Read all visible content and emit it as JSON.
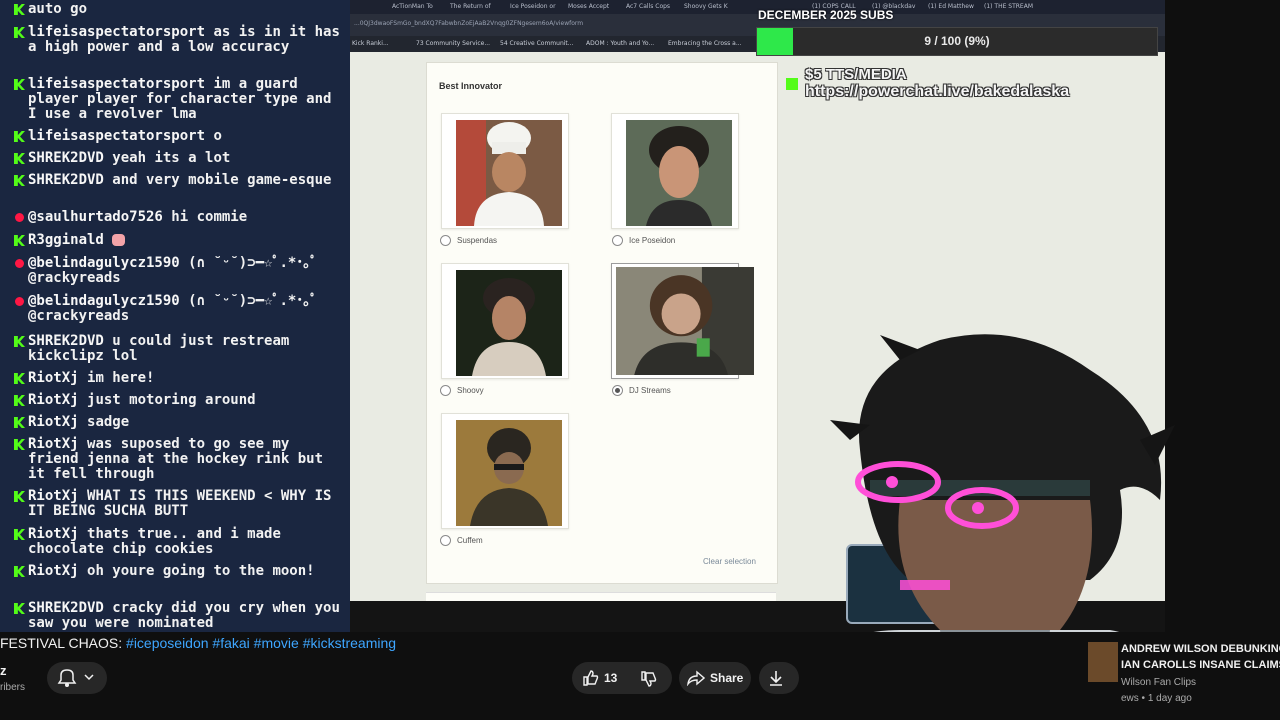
{
  "chat": {
    "messages": [
      {
        "platform": "kick",
        "user": "",
        "text": "auto go"
      },
      {
        "platform": "kick",
        "user": "lifeisaspectatorsport",
        "text": "as is in it has a high power and a low accuracy"
      },
      {
        "platform": "kick",
        "user": "lifeisaspectatorsport",
        "text": "im a guard player player for character type and I use a revolver lma"
      },
      {
        "platform": "kick",
        "user": "lifeisaspectatorsport",
        "text": "o"
      },
      {
        "platform": "kick",
        "user": "SHREK2DVD",
        "text": "yeah its a lot"
      },
      {
        "platform": "kick",
        "user": "SHREK2DVD",
        "text": "and very mobile game-esque"
      },
      {
        "platform": "youtube",
        "user": "@saulhurtado7526",
        "text": "hi commie"
      },
      {
        "platform": "kick",
        "user": "R3gginald",
        "text": ""
      },
      {
        "platform": "youtube",
        "user": "@belindagulycz1590",
        "text": "(∩ ˘ᵕ˘)⊃━☆ﾟ.*･｡ﾟ @rackyreads"
      },
      {
        "platform": "youtube",
        "user": "@belindagulycz1590",
        "text": "(∩ ˘ᵕ˘)⊃━☆ﾟ.*･｡ﾟ @crackyreads"
      },
      {
        "platform": "kick",
        "user": "SHREK2DVD",
        "text": "u could just restream kickclipz lol"
      },
      {
        "platform": "kick",
        "user": "RiotXj",
        "text": "im here!"
      },
      {
        "platform": "kick",
        "user": "RiotXj",
        "text": "just motoring around"
      },
      {
        "platform": "kick",
        "user": "RiotXj",
        "text": "sadge"
      },
      {
        "platform": "kick",
        "user": "RiotXj",
        "text": "was suposed to go see my friend jenna at the hockey rink but it fell through"
      },
      {
        "platform": "kick",
        "user": "RiotXj",
        "text": "WHAT IS THIS WEEKEND < WHY IS IT BEING SUCHA BUTT"
      },
      {
        "platform": "kick",
        "user": "RiotXj",
        "text": "thats true.. and i made chocolate chip cookies"
      },
      {
        "platform": "kick",
        "user": "RiotXj",
        "text": "oh youre going to the moon!"
      },
      {
        "platform": "kick",
        "user": "SHREK2DVD",
        "text": "cracky did you cry when you saw you were nominated"
      }
    ]
  },
  "browser": {
    "tabs": [
      "(1) COPS CALL",
      "(1) @blackdav",
      "(1) Ed Matthew",
      "(1) THE STREAM",
      "AcTionMan To",
      "The Return of",
      "Ice Poseidon or",
      "Moses Accept",
      "Ac7 Calls Cops",
      "Shoovy Gets K"
    ],
    "url": "...0QJ3dwaoFSmGo_bndXQ7FabwbnZoEjAaB2Vnqg0ZFNgesem6oA/viewform",
    "bookmarks": [
      "Kick Ranki...",
      "73 Community Service...",
      "54 Creative Communit...",
      "ADOM : Youth and Yo...",
      "Embracing the Cross a..."
    ],
    "form": {
      "section_title": "Best Innovator",
      "options": [
        "Suspendas",
        "Ice Poseidon",
        "Shoovy",
        "DJ Streams",
        "Cuffem"
      ],
      "selected": "DJ Streams",
      "clear_label": "Clear selection"
    }
  },
  "overlay": {
    "sub_goal_title": "DECEMBER 2025 SUBS",
    "sub_goal_text": "9 / 100 (9%)",
    "sub_goal_fraction": 0.09,
    "tts_line1": "$5 TTS/MEDIA",
    "tts_line2": "https://powerchat.live/bakedalaska"
  },
  "youtube": {
    "title_prefix": "FESTIVAL CHAOS: ",
    "title_tags": "#iceposeidon #fakai #movie #kickstreaming",
    "channel": "z",
    "subs": "ribers",
    "like_count": "13",
    "share_label": "Share",
    "rec_title_line1": "ANDREW WILSON DEBUNKING",
    "rec_title_line2": "IAN CAROLLS INSANE CLAIMS",
    "rec_channel": "Wilson Fan Clips",
    "rec_meta": "ews • 1 day ago"
  },
  "colors": {
    "kick_green": "#53fc18",
    "chat_bg": "#1a2640",
    "yt_bg": "#0f0f0f",
    "link_blue": "#3ea6ff"
  }
}
